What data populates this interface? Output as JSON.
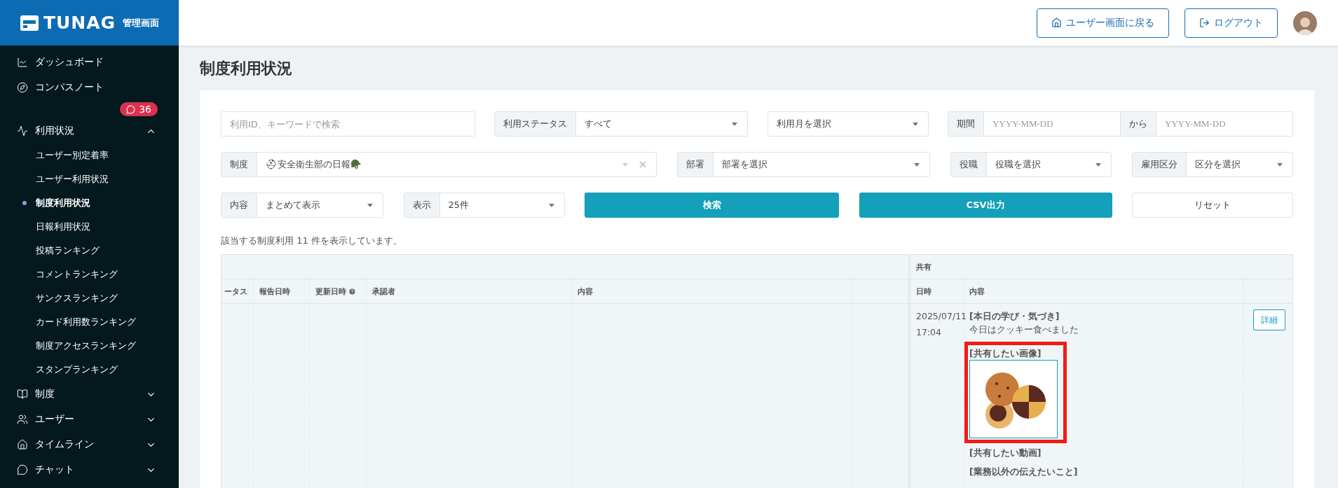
{
  "brand": {
    "logo": "TUNAG",
    "subtitle": "管理画面"
  },
  "header": {
    "buttons": [
      {
        "label": "ユーザー画面に戻る",
        "kind": "home"
      },
      {
        "label": "ログアウト",
        "kind": "logout"
      }
    ]
  },
  "sidebar": {
    "items": [
      {
        "label": "ダッシュボード",
        "kind": "dashboard"
      },
      {
        "label": "コンパスノート",
        "kind": "compass",
        "badge": "36"
      },
      {
        "label": "利用状況",
        "kind": "usage",
        "expanded": true,
        "children": [
          {
            "label": "ユーザー別定着率",
            "selected": false
          },
          {
            "label": "ユーザー利用状況",
            "selected": false
          },
          {
            "label": "制度利用状況",
            "selected": true
          },
          {
            "label": "日報利用状況",
            "selected": false
          },
          {
            "label": "投稿ランキング",
            "selected": false
          },
          {
            "label": "コメントランキング",
            "selected": false
          },
          {
            "label": "サンクスランキング",
            "selected": false
          },
          {
            "label": "カード利用数ランキング",
            "selected": false
          },
          {
            "label": "制度アクセスランキング",
            "selected": false
          },
          {
            "label": "スタンプランキング",
            "selected": false
          }
        ]
      },
      {
        "label": "制度",
        "kind": "system",
        "expanded": false
      },
      {
        "label": "ユーザー",
        "kind": "users",
        "expanded": false
      },
      {
        "label": "タイムライン",
        "kind": "timeline",
        "expanded": false
      },
      {
        "label": "チャット",
        "kind": "chat",
        "expanded": false
      }
    ]
  },
  "page_title": "制度利用状況",
  "filters": [
    [
      {
        "kind": "search",
        "placeholder": "利用ID、キーワードで検索"
      },
      {
        "kind": "select",
        "label": "利用ステータス",
        "value": "すべて"
      },
      {
        "kind": "select",
        "value": "利用月を選択"
      },
      {
        "kind": "daterange",
        "label": "期間",
        "from_placeholder": "YYYY-MM-DD",
        "separator": "から",
        "to_placeholder": "YYYY-MM-DD"
      }
    ],
    [
      {
        "kind": "select",
        "label": "制度",
        "value": "⛑安全衛生部の日報🪖",
        "clearable": true
      },
      {
        "kind": "select",
        "label": "部署",
        "value": "部署を選択"
      },
      {
        "kind": "select",
        "label": "役職",
        "value": "役職を選択"
      },
      {
        "kind": "select",
        "label": "雇用区分",
        "value": "区分を選択"
      }
    ],
    [
      {
        "kind": "select",
        "label": "内容",
        "value": "まとめて表示"
      },
      {
        "kind": "select",
        "label": "表示",
        "value": "25件"
      },
      {
        "kind": "button",
        "label": "検索"
      },
      {
        "kind": "button",
        "label": "CSV出力"
      },
      {
        "kind": "reset",
        "label": "リセット"
      }
    ]
  ],
  "result_text": "該当する制度利用 11 件を表示しています。",
  "table": {
    "group_label": "共有",
    "columns": [
      {
        "label": "ータス"
      },
      {
        "label": "報告日時"
      },
      {
        "label": "更新日時",
        "help": true
      },
      {
        "label": "承認者"
      },
      {
        "label": "内容"
      }
    ],
    "shared_columns": [
      {
        "label": "日時"
      },
      {
        "label": "内容"
      }
    ],
    "row": {
      "date": "2025/07/11",
      "time": "17:04",
      "action": "詳細",
      "sections": [
        {
          "heading": "[本日の学び・気づき]",
          "text": "今日はクッキー食べました"
        },
        {
          "heading": "[共有したい画像]",
          "kind": "image",
          "highlighted": true
        },
        {
          "heading": "[共有したい動画]"
        },
        {
          "heading": "[業務以外の伝えたいこと]"
        }
      ]
    }
  }
}
